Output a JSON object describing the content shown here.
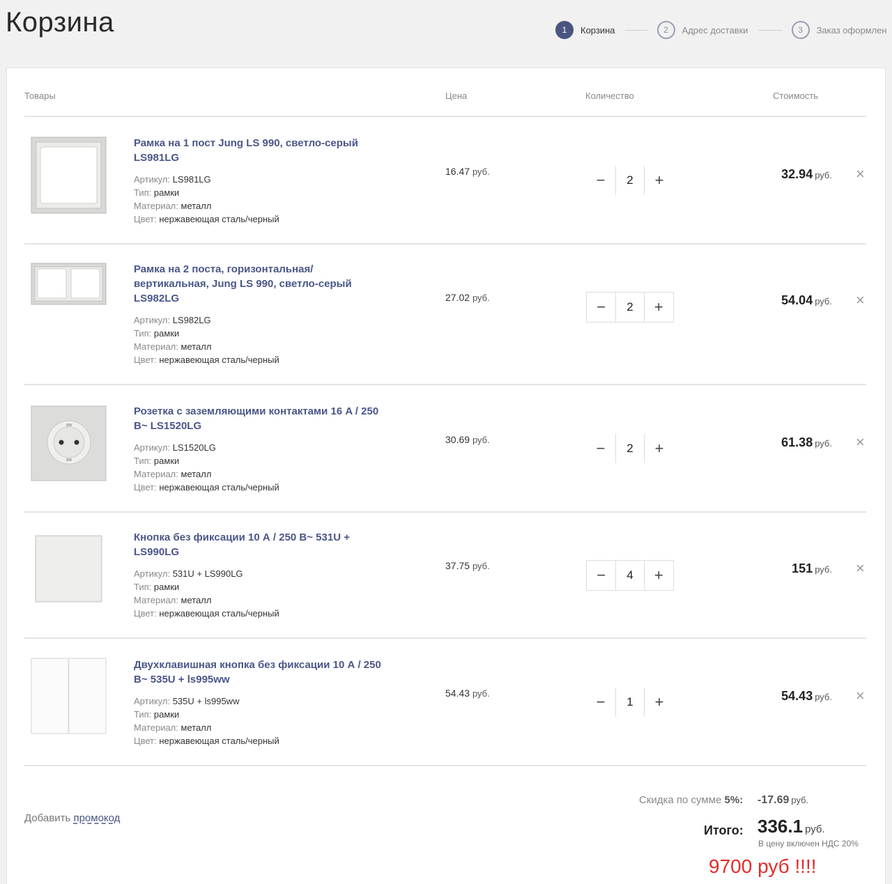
{
  "page_title": "Корзина",
  "steps": [
    {
      "num": "1",
      "label": "Корзина"
    },
    {
      "num": "2",
      "label": "Адрес доставки"
    },
    {
      "num": "3",
      "label": "Заказ оформлен"
    }
  ],
  "table_headers": {
    "goods": "Товары",
    "price": "Цена",
    "quantity": "Количество",
    "cost": "Стоимость"
  },
  "prop_labels": {
    "article": "Артикул:",
    "type": "Тип:",
    "material": "Материал:",
    "color": "Цвет:"
  },
  "currency": "руб.",
  "items": [
    {
      "title": "Рамка на 1 пост Jung LS 990, светло-серый LS981LG",
      "article": "LS981LG",
      "type": "рамки",
      "material": "металл",
      "color": "нержавеющая сталь/черный",
      "price": "16.47",
      "quantity": "2",
      "cost": "32.94",
      "image": "frame-1-icon"
    },
    {
      "title": "Рамка на 2 поста, горизонтальная/ вертикальная, Jung LS 990, светло-серый LS982LG",
      "article": "LS982LG",
      "type": "рамки",
      "material": "металл",
      "color": "нержавеющая сталь/черный",
      "price": "27.02",
      "quantity": "2",
      "cost": "54.04",
      "image": "frame-2-icon"
    },
    {
      "title": "Розетка с заземляющими контактами 16 A / 250 В~ LS1520LG",
      "article": "LS1520LG",
      "type": "рамки",
      "material": "металл",
      "color": "нержавеющая сталь/черный",
      "price": "30.69",
      "quantity": "2",
      "cost": "61.38",
      "image": "socket-icon"
    },
    {
      "title": "Кнопка без фиксации 10 А / 250 В~ 531U + LS990LG",
      "article": "531U + LS990LG",
      "type": "рамки",
      "material": "металл",
      "color": "нержавеющая сталь/черный",
      "price": "37.75",
      "quantity": "4",
      "cost": "151",
      "image": "button-icon"
    },
    {
      "title": "Двухклавишная кнопка без фиксации 10 А / 250 В~ 535U + ls995ww",
      "article": "535U + ls995ww",
      "type": "рамки",
      "material": "металл",
      "color": "нержавеющая сталь/черный",
      "price": "54.43",
      "quantity": "1",
      "cost": "54.43",
      "image": "double-button-icon"
    }
  ],
  "qty_controls": {
    "minus": "−",
    "plus": "+",
    "remove": "×"
  },
  "promo": {
    "prefix": "Добавить",
    "link": "промокод"
  },
  "summary": {
    "discount_label": "Скидка по сумме",
    "discount_percent": "5%:",
    "discount_value": "-17.69",
    "total_label": "Итого:",
    "total_value": "336.1",
    "vat_note": "В цену включен НДС 20%"
  },
  "annotation": "9700 руб !!!!",
  "colors": {
    "accent": "#4a5580",
    "link": "#4a5688",
    "annotation": "#e42c2c"
  }
}
